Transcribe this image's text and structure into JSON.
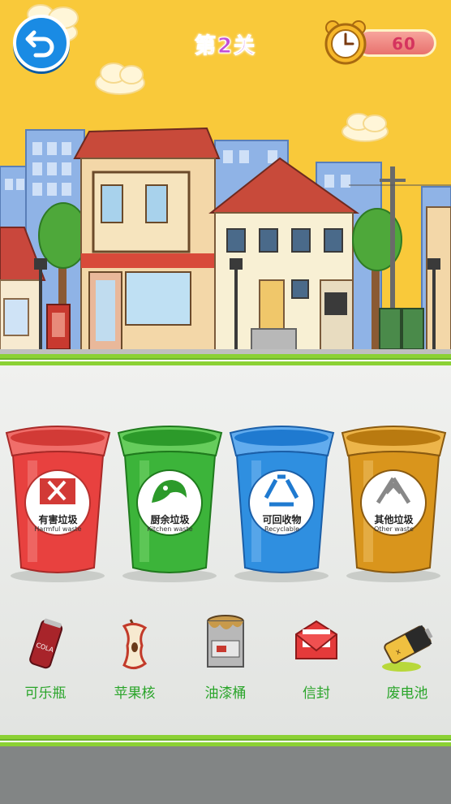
{
  "header": {
    "back_icon": "back-arrow-icon",
    "level_title": "第2关",
    "timer_icon": "alarm-clock-icon",
    "timer_value": "60"
  },
  "bins": [
    {
      "name_zh": "有害垃圾",
      "name_en": "Harmful waste",
      "color": "#e8413f",
      "icon": "harmful-waste-icon"
    },
    {
      "name_zh": "厨余垃圾",
      "name_en": "Kitchen waste",
      "color": "#3cb43a",
      "icon": "kitchen-waste-icon"
    },
    {
      "name_zh": "可回收物",
      "name_en": "Recyclable",
      "color": "#2f8fe0",
      "icon": "recycle-icon"
    },
    {
      "name_zh": "其他垃圾",
      "name_en": "Other waste",
      "color": "#d9951c",
      "icon": "other-waste-icon"
    }
  ],
  "items": [
    {
      "label": "可乐瓶",
      "icon": "cola-can-icon"
    },
    {
      "label": "苹果核",
      "icon": "apple-core-icon"
    },
    {
      "label": "油漆桶",
      "icon": "paint-bucket-icon"
    },
    {
      "label": "信封",
      "icon": "envelope-icon"
    },
    {
      "label": "废电池",
      "icon": "battery-icon"
    }
  ],
  "cola_can_text": "COLA",
  "colors": {
    "sky": "#f9c93a",
    "ground": "#8bd134",
    "label_green": "#2aa52a",
    "title_purple": "#c24fd6"
  }
}
